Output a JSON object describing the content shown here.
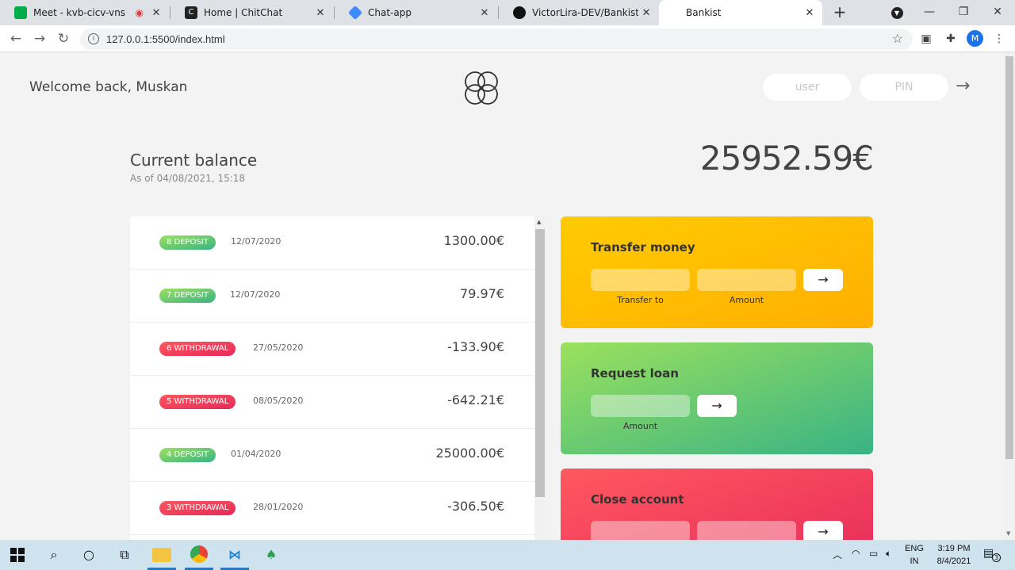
{
  "browser": {
    "tabs": [
      {
        "title": "Meet - kvb-cicv-vns",
        "favicon_color": "#00ac47",
        "recording": true
      },
      {
        "title": "Home | ChitChat",
        "favicon_color": "#222222"
      },
      {
        "title": "Chat-app",
        "favicon_color": "#3d8bfd"
      },
      {
        "title": "VictorLira-DEV/Bankist: Bakist",
        "favicon_color": "#111111"
      },
      {
        "title": "Bankist",
        "favicon_color": "#ffffff",
        "active": true
      }
    ],
    "new_tab": "+",
    "url": "127.0.0.1:5500/index.html",
    "profile_initial": "M"
  },
  "app": {
    "welcome": "Welcome back, Muskan",
    "login": {
      "user_placeholder": "user",
      "pin_placeholder": "PIN",
      "arrow": "→"
    },
    "balance": {
      "label": "Current balance",
      "date_prefix": "As of",
      "date": "As of 04/08/2021, 15:18",
      "value": "25952.59€"
    },
    "movements": [
      {
        "type": "deposit",
        "label": "8 deposit",
        "date": "12/07/2020",
        "amount": "1300.00€"
      },
      {
        "type": "deposit",
        "label": "7 deposit",
        "date": "12/07/2020",
        "amount": "79.97€"
      },
      {
        "type": "withdrawal",
        "label": "6 withdrawal",
        "date": "27/05/2020",
        "amount": "-133.90€"
      },
      {
        "type": "withdrawal",
        "label": "5 withdrawal",
        "date": "08/05/2020",
        "amount": "-642.21€"
      },
      {
        "type": "deposit",
        "label": "4 deposit",
        "date": "01/04/2020",
        "amount": "25000.00€"
      },
      {
        "type": "withdrawal",
        "label": "3 withdrawal",
        "date": "28/01/2020",
        "amount": "-306.50€"
      }
    ],
    "operations": {
      "transfer": {
        "title": "Transfer money",
        "label_to": "Transfer to",
        "label_amount": "Amount",
        "button": "→"
      },
      "loan": {
        "title": "Request loan",
        "label_amount": "Amount",
        "button": "→"
      },
      "close": {
        "title": "Close account",
        "button": "→"
      }
    }
  },
  "taskbar": {
    "lang_top": "ENG",
    "lang_bottom": "IN",
    "time": "3:19 PM",
    "date": "8/4/2021",
    "notifications": "3"
  },
  "colors": {
    "deposit": "#39b385",
    "withdrawal": "#e52a5a",
    "transfer": "#ffb003",
    "loan": "#6fcf6a",
    "close": "#f0455e"
  }
}
